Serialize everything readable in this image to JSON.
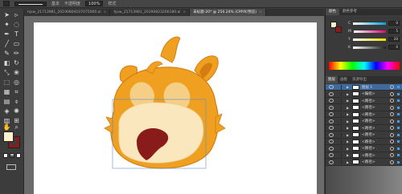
{
  "control_bar": {
    "stroke_width_field": "",
    "style_label": "基本",
    "opacity_label": "不透明度",
    "opacity_value": "100%",
    "style_field": "样式"
  },
  "tabs": [
    {
      "label": "hjsw_21713981_20190804107075000.ai",
      "active": false
    },
    {
      "label": "hjsw_21713981_20190823206180.ai",
      "active": false
    },
    {
      "label": "未标题-20* @ 250.24% (CMYK/预览)",
      "active": true
    }
  ],
  "color_panel": {
    "tabs": [
      "颜色",
      "颜色参考"
    ],
    "sliders": [
      {
        "channel": "C",
        "value": "0",
        "color": "#00a0e0"
      },
      {
        "channel": "M",
        "value": "5",
        "color": "#e0007a"
      },
      {
        "channel": "Y",
        "value": "20",
        "color": "#f0e000"
      },
      {
        "channel": "K",
        "value": "0",
        "color": "#222222"
      }
    ],
    "fill_color": "#fdf0cf",
    "stroke_color": "#8a1b1b"
  },
  "layers_panel": {
    "tabs": [
      "图层",
      "画板",
      "资源导出"
    ],
    "layers": [
      {
        "name": "图层 1",
        "selected": true
      },
      {
        "name": "<编组>",
        "selected": false
      },
      {
        "name": "<路径>",
        "selected": false
      },
      {
        "name": "<路径>",
        "selected": false
      },
      {
        "name": "<路径>",
        "selected": false
      },
      {
        "name": "<路径>",
        "selected": false
      },
      {
        "name": "<路径>",
        "selected": false
      },
      {
        "name": "<路径>",
        "selected": false
      },
      {
        "name": "<路径>",
        "selected": false
      },
      {
        "name": "<路径>",
        "selected": false
      },
      {
        "name": "<路径>",
        "selected": false
      },
      {
        "name": "<路径>",
        "selected": false
      }
    ]
  },
  "artwork": {
    "fur_color": "#f0a020",
    "fur_dark": "#d57d10",
    "face_color": "#fbe7bd",
    "mouth_color": "#8a1b1b"
  },
  "tool_icons": [
    "selection-icon",
    "direct-selection-icon",
    "magic-wand-icon",
    "lasso-icon",
    "pen-icon",
    "type-icon",
    "line-icon",
    "rectangle-icon",
    "paintbrush-icon",
    "pencil-icon",
    "eraser-icon",
    "rotate-icon",
    "scale-icon",
    "warp-icon",
    "free-transform-icon",
    "shape-builder-icon",
    "perspective-icon",
    "mesh-icon",
    "gradient-icon",
    "eyedropper-icon",
    "blend-icon",
    "symbol-sprayer-icon",
    "graph-icon",
    "artboard-icon",
    "slice-icon",
    "hand-icon",
    "zoom-icon"
  ]
}
